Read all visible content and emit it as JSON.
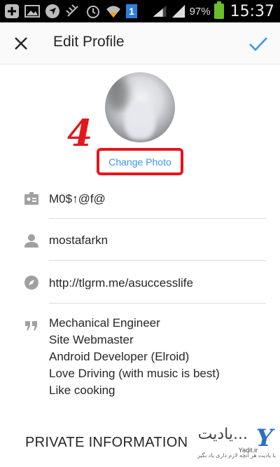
{
  "status_bar": {
    "battery_pct": "97%",
    "time": "15:37",
    "sim_badge": "1",
    "icons": [
      "add-icon",
      "image-icon",
      "navigation-icon",
      "signal-off-icon",
      "alarm-icon",
      "wifi-icon",
      "sim-icon",
      "signal-icon",
      "battery-icon"
    ]
  },
  "app_bar": {
    "title": "Edit Profile",
    "close_icon": "close-icon",
    "done_icon": "check-icon",
    "accent": "#3897f0"
  },
  "profile": {
    "change_photo_label": "Change Photo",
    "annotation_number": "4",
    "annotation_color": "#e3161b"
  },
  "fields": {
    "name": {
      "icon": "id-card-icon",
      "value": "M0$↑@f@"
    },
    "username": {
      "icon": "person-icon",
      "value": "mostafarkn"
    },
    "website": {
      "icon": "compass-icon",
      "value": "http://tlgrm.me/asuccesslife"
    },
    "bio": {
      "icon": "quote-icon",
      "lines": [
        "Mechanical Engineer",
        "Site Webmaster",
        "Android Developer (Elroid)",
        "Love Driving (with music is best)",
        "Like cooking"
      ]
    }
  },
  "sections": {
    "private_title": "PRIVATE INFORMATION"
  },
  "watermark": {
    "text_fa": "یادیت...",
    "logo": "Y",
    "site": "Yadit.ir",
    "tagline": "با یادیت هر آنچه لازم داری یاد بگیر"
  }
}
